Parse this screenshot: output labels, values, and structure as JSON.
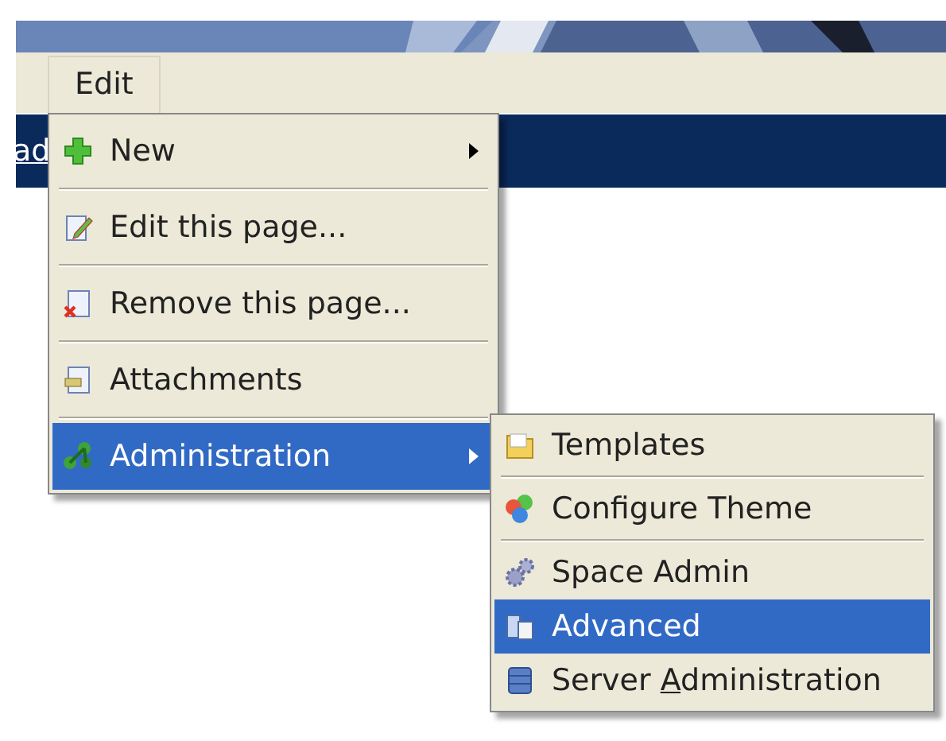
{
  "page_link": {
    "label": "ad"
  },
  "menu_bar": {
    "items": [
      {
        "label": "Edit",
        "selected": true
      }
    ]
  },
  "edit_menu": {
    "groups": [
      [
        {
          "label": "New",
          "selected": false,
          "has_submenu": true
        }
      ],
      [
        {
          "label": "Edit this page...",
          "selected": false,
          "has_submenu": false
        }
      ],
      [
        {
          "label": "Remove this page...",
          "selected": false,
          "has_submenu": false
        }
      ],
      [
        {
          "label": "Attachments",
          "selected": false,
          "has_submenu": false
        }
      ],
      [
        {
          "label": "Administration",
          "selected": true,
          "has_submenu": true
        }
      ]
    ]
  },
  "administration_submenu": {
    "groups": [
      [
        {
          "label": "Templates",
          "selected": false
        }
      ],
      [
        {
          "label": "Configure Theme",
          "selected": false
        }
      ],
      [
        {
          "label": "Space Admin",
          "selected": false
        },
        {
          "label": "Advanced",
          "selected": true
        },
        {
          "label": "Server ",
          "mnemonic": "A",
          "label_rest": "dministration",
          "selected": false
        }
      ]
    ]
  }
}
